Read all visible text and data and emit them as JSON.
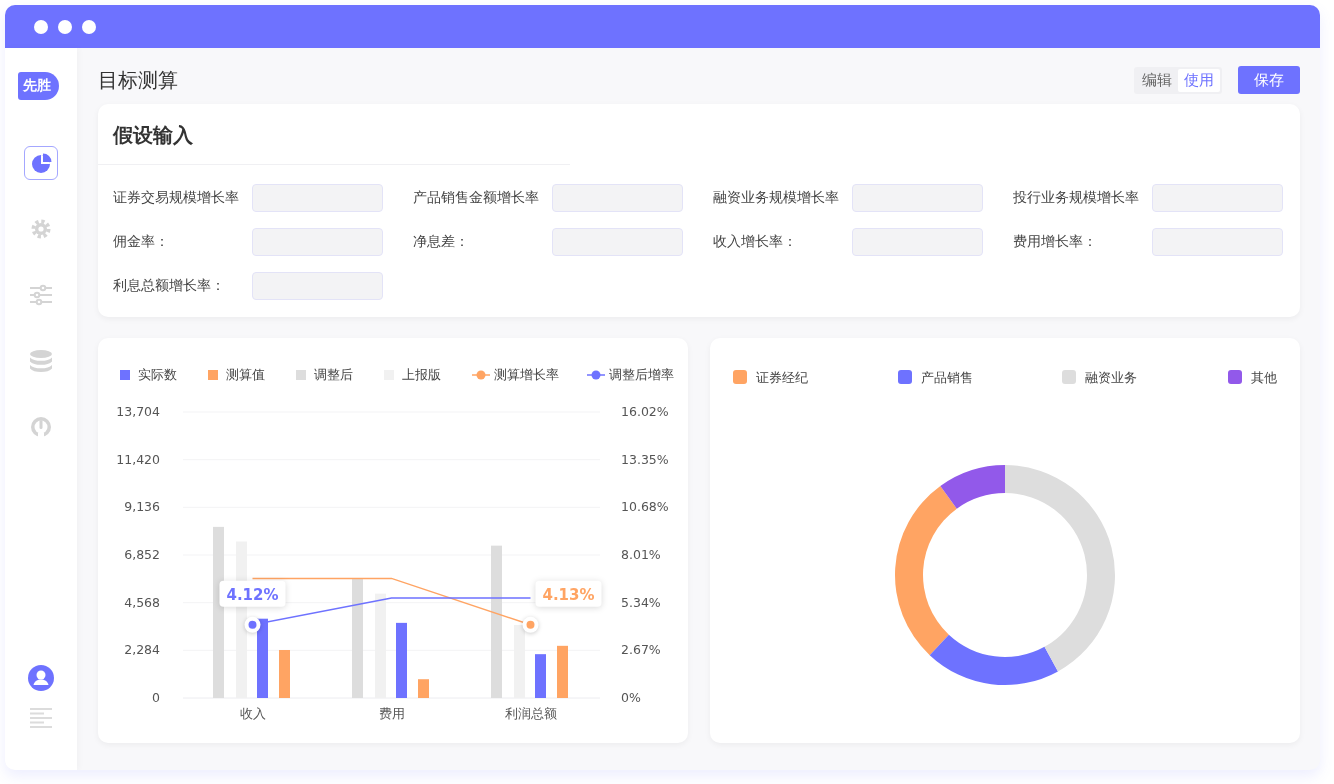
{
  "logo": "先胜",
  "nav": [
    {
      "kind": "pie",
      "selected": true
    },
    {
      "kind": "gear",
      "selected": false
    },
    {
      "kind": "sliders",
      "selected": false
    },
    {
      "kind": "database",
      "selected": false
    },
    {
      "kind": "gauge",
      "selected": false
    }
  ],
  "page_title": "目标测算",
  "mode_tabs": [
    {
      "label": "编辑",
      "selected": false
    },
    {
      "label": "使用",
      "selected": true
    }
  ],
  "save_button": "保存",
  "assumptions": {
    "title": "假设输入",
    "fields": [
      {
        "label": "证券交易规模增长率"
      },
      {
        "label": "产品销售金额增长率"
      },
      {
        "label": "融资业务规模增长率"
      },
      {
        "label": "投行业务规模增长率"
      },
      {
        "label": "佣金率："
      },
      {
        "label": "净息差："
      },
      {
        "label": "收入增长率："
      },
      {
        "label": "费用增长率："
      },
      {
        "label": "利息总额增长率："
      }
    ]
  },
  "bar_chart": {
    "chart_data": {
      "type": "bar",
      "categories": [
        "收入",
        "费用",
        "利润总额"
      ],
      "series": [
        {
          "name": "实际数",
          "color": "#6e72ff",
          "type": "bar",
          "values": [
            3800,
            3600,
            2100
          ]
        },
        {
          "name": "测算值",
          "color": "#ffa463",
          "type": "bar",
          "values": [
            2300,
            900,
            2500
          ]
        },
        {
          "name": "调整后",
          "color": "#dddddd",
          "type": "bar",
          "values": [
            8200,
            5700,
            7300
          ]
        },
        {
          "name": "上报版",
          "color": "#f1f1f1",
          "type": "bar",
          "values": [
            7500,
            5000,
            3500
          ]
        },
        {
          "name": "测算增长率",
          "color": "#ffa463",
          "type": "line",
          "axis": "y2",
          "values": [
            6.7,
            6.7,
            4.1
          ]
        },
        {
          "name": "调整后增率",
          "color": "#6e72ff",
          "type": "line",
          "axis": "y2",
          "values": [
            4.1,
            5.6,
            5.6
          ]
        }
      ],
      "grid": true,
      "legend": "top",
      "ylim": [
        0,
        13704
      ],
      "yticks": [
        {
          "value": 0,
          "label": "0"
        },
        {
          "value": 2284,
          "label": "2,284"
        },
        {
          "value": 4568,
          "label": "4,568"
        },
        {
          "value": 6852,
          "label": "6,852"
        },
        {
          "value": 9136,
          "label": "9,136"
        },
        {
          "value": 11420,
          "label": "11,420"
        },
        {
          "value": 13704,
          "label": "13,704"
        }
      ],
      "y2lim": [
        0,
        16.02
      ],
      "y2ticks": [
        {
          "value": 0,
          "label": "0%"
        },
        {
          "value": 2.67,
          "label": "2.67%"
        },
        {
          "value": 5.34,
          "label": "5.34%"
        },
        {
          "value": 8.01,
          "label": "8.01%"
        },
        {
          "value": 10.68,
          "label": "10.68%"
        },
        {
          "value": 13.35,
          "label": "13.35%"
        },
        {
          "value": 16.02,
          "label": "16.02%"
        }
      ],
      "annotations": [
        "4.12%",
        "4.13%"
      ]
    }
  },
  "donut": {
    "legend": [
      {
        "label": "证券经纪",
        "color": "#ffa463"
      },
      {
        "label": "产品销售",
        "color": "#6e72ff"
      },
      {
        "label": "融资业务",
        "color": "#dddddd"
      },
      {
        "label": "其他",
        "color": "#9259ea"
      }
    ]
  }
}
